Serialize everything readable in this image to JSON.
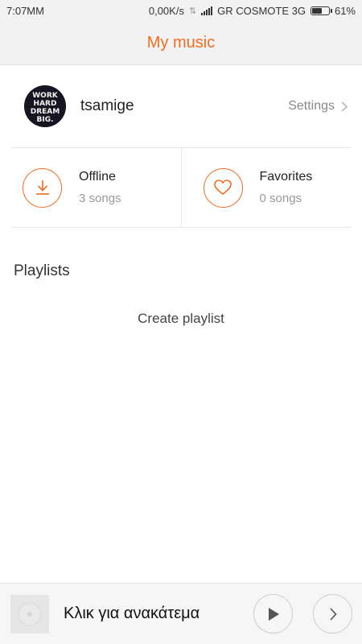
{
  "status_bar": {
    "time": "7:07ΜΜ",
    "network_speed": "0,00K/s",
    "carrier": "GR COSMOTE 3G",
    "battery_level": 0.61,
    "battery_label": "61%"
  },
  "header": {
    "title": "My music"
  },
  "profile": {
    "avatar_text": [
      "WORK",
      "HARD",
      "DREAM",
      "BIG."
    ],
    "username": "tsamige",
    "settings_label": "Settings"
  },
  "stats": {
    "offline": {
      "label": "Offline",
      "count": "3 songs"
    },
    "favorites": {
      "label": "Favorites",
      "count": "0 songs"
    }
  },
  "playlists": {
    "title": "Playlists",
    "create_label": "Create playlist"
  },
  "player": {
    "track_text": "Κλικ για ανακάτεμα"
  },
  "colors": {
    "accent": "#f26c1f",
    "background": "#ffffff",
    "bar_background": "#f2f2f2"
  },
  "icons": [
    "signal-icon",
    "battery-icon",
    "chevron-right-icon",
    "download-icon",
    "heart-icon",
    "disc-icon",
    "play-icon",
    "next-icon"
  ]
}
